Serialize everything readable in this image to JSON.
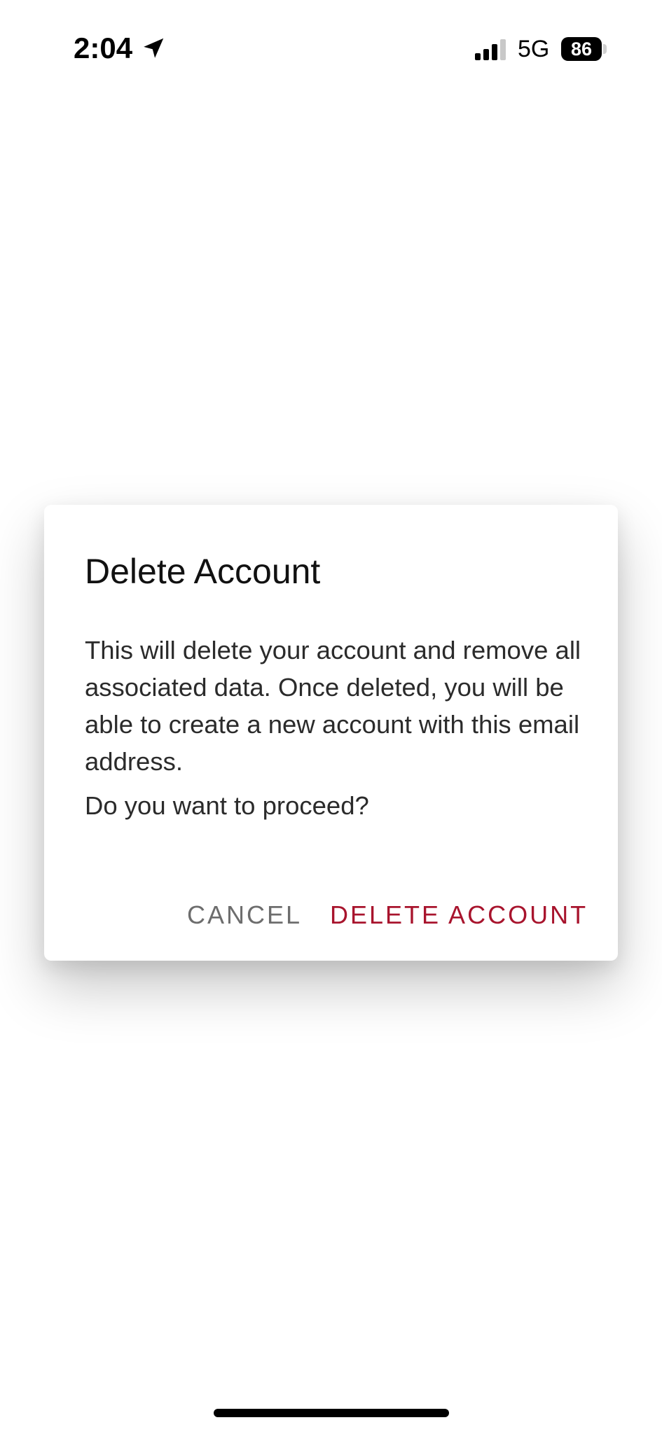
{
  "status_bar": {
    "time": "2:04",
    "network": "5G",
    "battery_level": "86",
    "icons": [
      "location-arrow-icon",
      "cellular-signal-icon",
      "battery-icon"
    ]
  },
  "dialog": {
    "title": "Delete Account",
    "message": "This will delete your account and remove all associated data. Once deleted, you will be able to create a new account with this email address.",
    "question": "Do you want to proceed?",
    "cancel_label": "CANCEL",
    "confirm_label": "DELETE ACCOUNT",
    "confirm_color": "#a8142d",
    "cancel_color": "#6d6d6d"
  }
}
